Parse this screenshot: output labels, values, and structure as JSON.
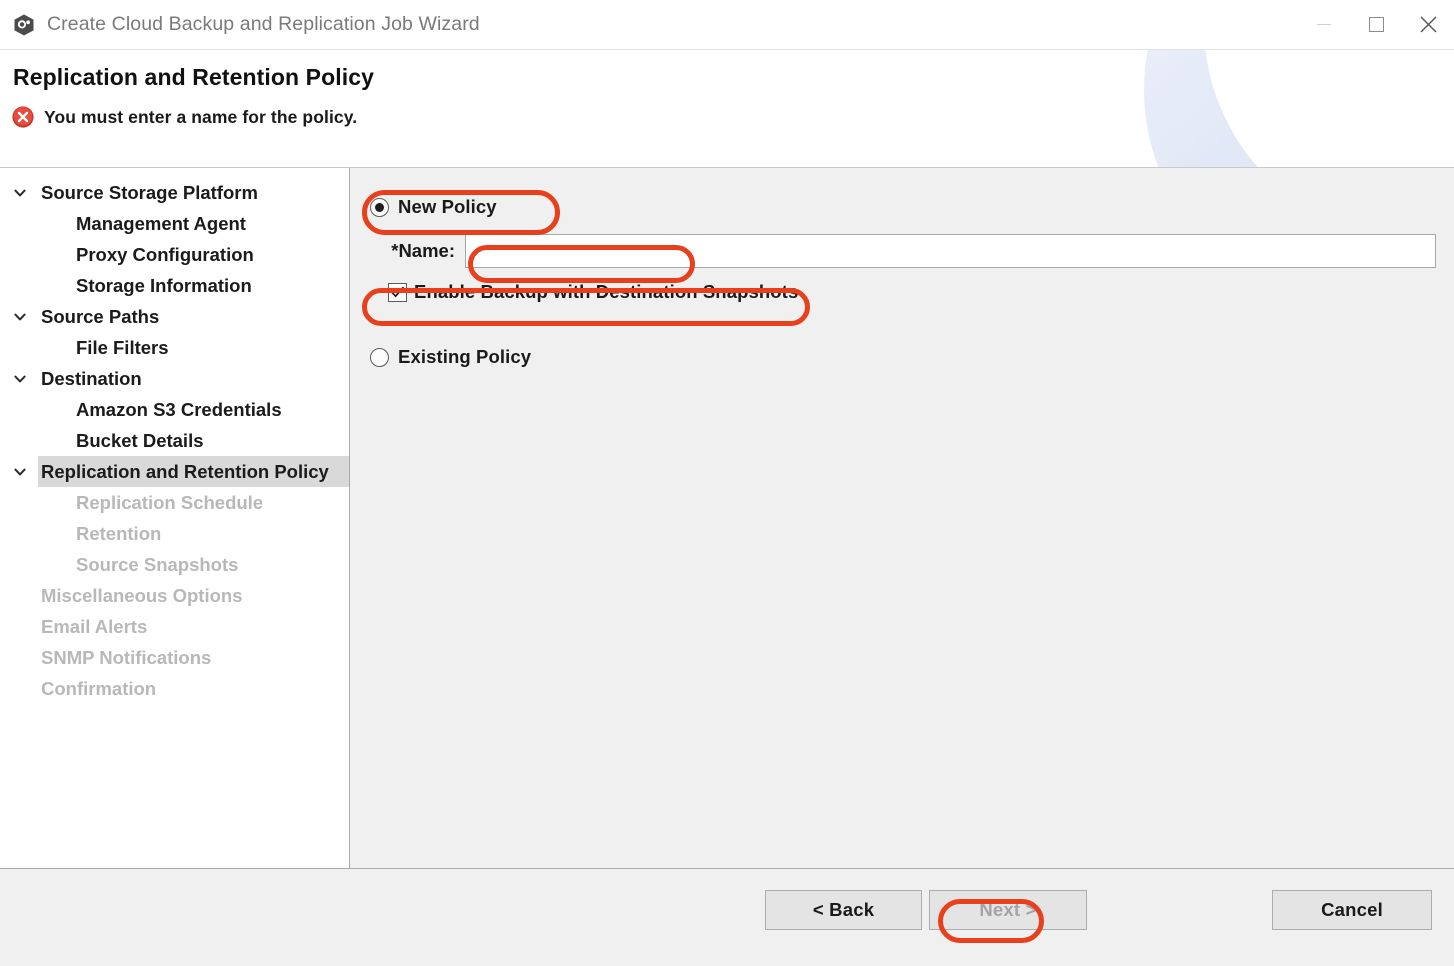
{
  "window": {
    "title": "Create Cloud Backup and Replication Job Wizard",
    "app_icon": "cloud-backup-app-icon",
    "controls": {
      "minimize": "minimize-icon",
      "maximize": "maximize-icon",
      "close": "close-icon"
    }
  },
  "header": {
    "title": "Replication and Retention Policy",
    "message": "You must enter a name for the policy.",
    "message_icon": "error-icon"
  },
  "sidebar": {
    "items": [
      {
        "label": "Source Storage Platform",
        "level": 0,
        "expandable": true,
        "disabled": false,
        "selected": false
      },
      {
        "label": "Management Agent",
        "level": 1,
        "expandable": false,
        "disabled": false,
        "selected": false
      },
      {
        "label": "Proxy Configuration",
        "level": 1,
        "expandable": false,
        "disabled": false,
        "selected": false
      },
      {
        "label": "Storage Information",
        "level": 1,
        "expandable": false,
        "disabled": false,
        "selected": false
      },
      {
        "label": "Source Paths",
        "level": 0,
        "expandable": true,
        "disabled": false,
        "selected": false
      },
      {
        "label": "File Filters",
        "level": 1,
        "expandable": false,
        "disabled": false,
        "selected": false
      },
      {
        "label": "Destination",
        "level": 0,
        "expandable": true,
        "disabled": false,
        "selected": false
      },
      {
        "label": "Amazon S3 Credentials",
        "level": 1,
        "expandable": false,
        "disabled": false,
        "selected": false
      },
      {
        "label": "Bucket Details",
        "level": 1,
        "expandable": false,
        "disabled": false,
        "selected": false
      },
      {
        "label": "Replication and Retention Policy",
        "level": 0,
        "expandable": true,
        "disabled": false,
        "selected": true
      },
      {
        "label": "Replication Schedule",
        "level": 1,
        "expandable": false,
        "disabled": true,
        "selected": false
      },
      {
        "label": "Retention",
        "level": 1,
        "expandable": false,
        "disabled": true,
        "selected": false
      },
      {
        "label": "Source Snapshots",
        "level": 1,
        "expandable": false,
        "disabled": true,
        "selected": false
      },
      {
        "label": "Miscellaneous Options",
        "level": 0,
        "expandable": false,
        "disabled": true,
        "selected": false
      },
      {
        "label": "Email Alerts",
        "level": 0,
        "expandable": false,
        "disabled": true,
        "selected": false
      },
      {
        "label": "SNMP Notifications",
        "level": 0,
        "expandable": false,
        "disabled": true,
        "selected": false
      },
      {
        "label": "Confirmation",
        "level": 0,
        "expandable": false,
        "disabled": true,
        "selected": false
      }
    ]
  },
  "main": {
    "new_policy": {
      "label": "New Policy",
      "selected": true
    },
    "name": {
      "label": "*Name:",
      "value": "",
      "placeholder": ""
    },
    "enable_backup": {
      "label": "Enable Backup with Destination Snapshots",
      "checked": true
    },
    "existing_policy": {
      "label": "Existing Policy",
      "selected": false
    }
  },
  "footer": {
    "back": {
      "label": "< Back",
      "disabled": false
    },
    "next": {
      "label": "Next >",
      "disabled": true
    },
    "cancel": {
      "label": "Cancel",
      "disabled": false
    }
  },
  "annotations": {
    "color": "#e8401c",
    "targets": [
      "New Policy radio",
      "Name input field",
      "Enable Backup with Destination Snapshots checkbox",
      "Next > button"
    ]
  }
}
